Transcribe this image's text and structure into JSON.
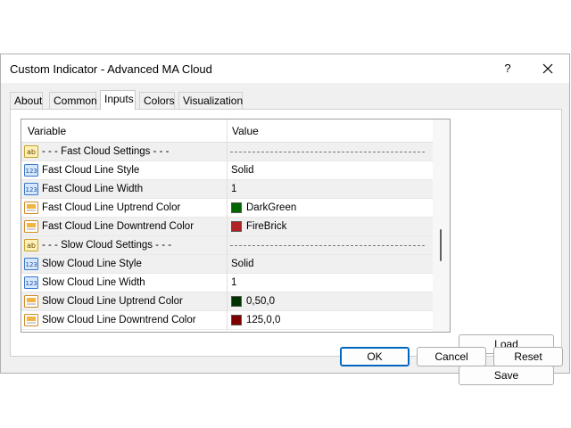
{
  "window": {
    "title": "Custom Indicator - Advanced MA Cloud",
    "help": "?"
  },
  "tabs": [
    {
      "label": "About"
    },
    {
      "label": "Common"
    },
    {
      "label": "Inputs"
    },
    {
      "label": "Colors"
    },
    {
      "label": "Visualization"
    }
  ],
  "grid": {
    "columns": {
      "variable": "Variable",
      "value": "Value"
    },
    "rows": [
      {
        "icon": "ab-icon",
        "variable": "- - - Fast Cloud Settings - - -",
        "value": "",
        "type": "separator"
      },
      {
        "icon": "123-icon",
        "variable": "Fast Cloud Line Style",
        "value": "Solid",
        "type": "text"
      },
      {
        "icon": "123-icon",
        "variable": "Fast Cloud Line Width",
        "value": "1",
        "type": "text"
      },
      {
        "icon": "color-icon",
        "variable": "Fast Cloud Line Uptrend Color",
        "value": "DarkGreen",
        "type": "color",
        "color": "#006400"
      },
      {
        "icon": "color-icon",
        "variable": "Fast Cloud Line Downtrend Color",
        "value": "FireBrick",
        "type": "color",
        "color": "#b22222"
      },
      {
        "icon": "ab-icon",
        "variable": "- - - Slow Cloud Settings - - -",
        "value": "",
        "type": "separator"
      },
      {
        "icon": "123-icon",
        "variable": "Slow Cloud Line Style",
        "value": "Solid",
        "type": "text"
      },
      {
        "icon": "123-icon",
        "variable": "Slow Cloud Line Width",
        "value": "1",
        "type": "text"
      },
      {
        "icon": "color-icon",
        "variable": "Slow Cloud Line Uptrend Color",
        "value": "0,50,0",
        "type": "color",
        "color": "#003200"
      },
      {
        "icon": "color-icon",
        "variable": "Slow Cloud Line Downtrend Color",
        "value": "125,0,0",
        "type": "color",
        "color": "#7d0000"
      }
    ]
  },
  "side_buttons": {
    "load": "Load",
    "save": "Save"
  },
  "footer_buttons": {
    "ok": "OK",
    "cancel": "Cancel",
    "reset": "Reset"
  }
}
